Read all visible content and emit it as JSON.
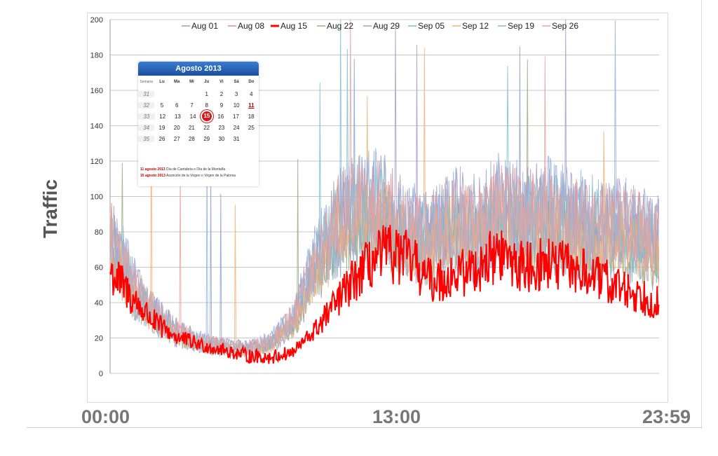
{
  "chart_data": {
    "type": "line",
    "ylabel": "Traffic",
    "ylim": [
      0,
      200
    ],
    "yticks": [
      0,
      20,
      40,
      60,
      80,
      100,
      120,
      140,
      160,
      180,
      200
    ],
    "x_tick_labels": [
      "00:00",
      "13:00",
      "23:59"
    ],
    "xlim_minutes": [
      0,
      1439
    ],
    "legend_position": "top",
    "grid": true,
    "series": [
      {
        "name": "Aug 01",
        "color": "#8fa1c9",
        "highlight": false
      },
      {
        "name": "Aug 08",
        "color": "#d9909a",
        "highlight": false
      },
      {
        "name": "Aug 15",
        "color": "#ff0000",
        "highlight": true
      },
      {
        "name": "Aug 22",
        "color": "#9aab8a",
        "highlight": false
      },
      {
        "name": "Aug 29",
        "color": "#a79bc6",
        "highlight": false
      },
      {
        "name": "Sep 05",
        "color": "#7cc0d0",
        "highlight": false
      },
      {
        "name": "Sep 12",
        "color": "#f0b27a",
        "highlight": false
      },
      {
        "name": "Sep 19",
        "color": "#97b3d8",
        "highlight": false
      },
      {
        "name": "Sep 26",
        "color": "#e4a2a2",
        "highlight": false
      }
    ],
    "profile_normal": [
      [
        0,
        75
      ],
      [
        60,
        48
      ],
      [
        120,
        32
      ],
      [
        180,
        22
      ],
      [
        240,
        17
      ],
      [
        300,
        15
      ],
      [
        360,
        14
      ],
      [
        420,
        17
      ],
      [
        480,
        30
      ],
      [
        540,
        62
      ],
      [
        600,
        85
      ],
      [
        660,
        92
      ],
      [
        720,
        90
      ],
      [
        780,
        78
      ],
      [
        840,
        75
      ],
      [
        900,
        85
      ],
      [
        960,
        80
      ],
      [
        1020,
        90
      ],
      [
        1080,
        85
      ],
      [
        1140,
        88
      ],
      [
        1200,
        85
      ],
      [
        1260,
        80
      ],
      [
        1320,
        82
      ],
      [
        1380,
        78
      ],
      [
        1439,
        72
      ]
    ],
    "profile_aug15": [
      [
        0,
        58
      ],
      [
        60,
        42
      ],
      [
        120,
        28
      ],
      [
        180,
        20
      ],
      [
        240,
        16
      ],
      [
        300,
        13
      ],
      [
        360,
        10
      ],
      [
        420,
        9
      ],
      [
        480,
        12
      ],
      [
        540,
        25
      ],
      [
        600,
        42
      ],
      [
        660,
        58
      ],
      [
        720,
        68
      ],
      [
        780,
        65
      ],
      [
        840,
        52
      ],
      [
        900,
        55
      ],
      [
        960,
        60
      ],
      [
        1020,
        68
      ],
      [
        1080,
        60
      ],
      [
        1140,
        62
      ],
      [
        1200,
        60
      ],
      [
        1260,
        55
      ],
      [
        1320,
        50
      ],
      [
        1380,
        45
      ],
      [
        1439,
        40
      ]
    ]
  },
  "calendar": {
    "title": "Agosto 2013",
    "weekday_headers": [
      "Semana",
      "Lu",
      "Ma",
      "Mi",
      "Ju",
      "Vi",
      "Sá",
      "Do"
    ],
    "weeks": [
      [
        "31",
        "",
        "",
        "",
        "1",
        "2",
        "3",
        "4"
      ],
      [
        "32",
        "5",
        "6",
        "7",
        "8",
        "9",
        "10",
        "11"
      ],
      [
        "33",
        "12",
        "13",
        "14",
        "15",
        "16",
        "17",
        "18"
      ],
      [
        "34",
        "19",
        "20",
        "21",
        "22",
        "23",
        "24",
        "25"
      ],
      [
        "35",
        "26",
        "27",
        "28",
        "29",
        "30",
        "31",
        ""
      ]
    ],
    "holiday_day": "11",
    "highlight_day": "15",
    "notes": [
      {
        "date": "11 agosto 2013",
        "text": "Día de Cantabria o Día de la Montaña"
      },
      {
        "date": "15 agosto 2013",
        "text": "Asunción de la Virgen o Virgen de la Paloma"
      }
    ]
  }
}
